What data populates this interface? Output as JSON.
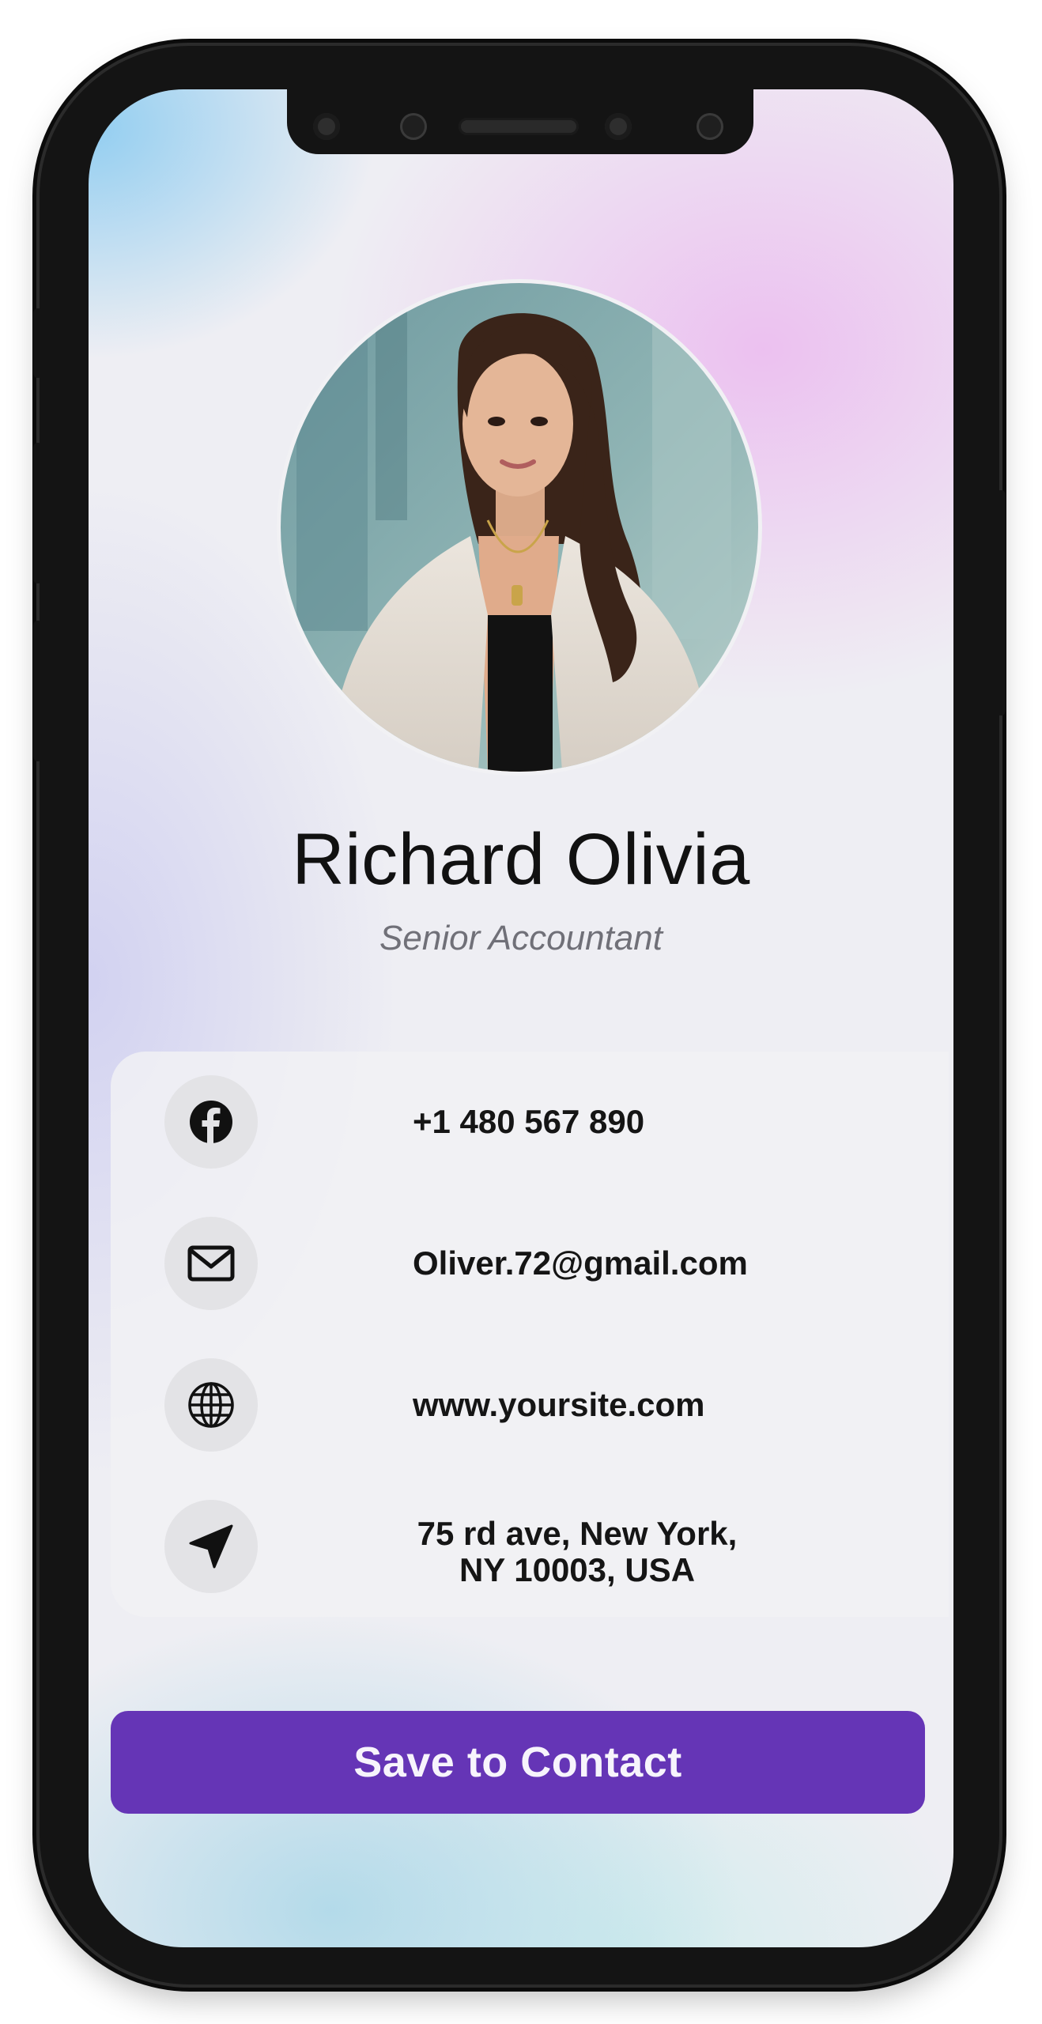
{
  "profile": {
    "name": "Richard Olivia",
    "title": "Senior Accountant"
  },
  "contacts": [
    {
      "icon": "facebook-icon",
      "text": "+1 480 567 890"
    },
    {
      "icon": "mail-icon",
      "text": "Oliver.72@gmail.com"
    },
    {
      "icon": "globe-icon",
      "text": "www.yoursite.com"
    },
    {
      "icon": "location-arrow-icon",
      "line1": "75 rd ave, New York,",
      "line2": "NY 10003, USA"
    }
  ],
  "actions": {
    "save_label": "Save to Contact"
  },
  "colors": {
    "accent": "#6535b6",
    "text": "#111111",
    "subtitle": "#707078",
    "icon_bg": "#e3e3e6"
  }
}
